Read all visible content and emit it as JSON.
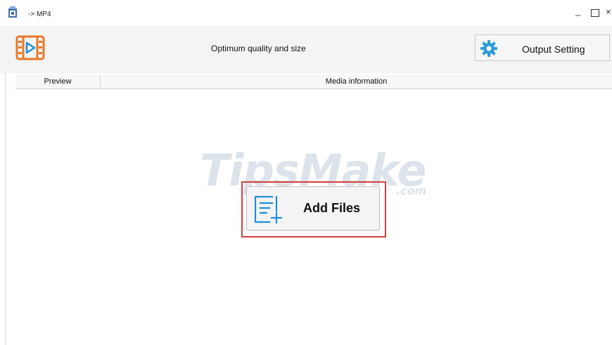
{
  "window": {
    "title": "-> MP4",
    "controls": {
      "minimize": "_",
      "close": "×"
    }
  },
  "toolbar": {
    "profile_label": "Optimum quality and size",
    "output_setting_label": "Output Setting"
  },
  "table": {
    "headers": [
      "Preview",
      "Media information"
    ]
  },
  "watermark": {
    "text": "TipsMake",
    "suffix": ".com"
  },
  "main": {
    "add_files_label": "Add Files"
  },
  "colors": {
    "accent_orange": "#e8782a",
    "accent_blue": "#1e8fd6",
    "highlight_red": "#d63d3d"
  }
}
